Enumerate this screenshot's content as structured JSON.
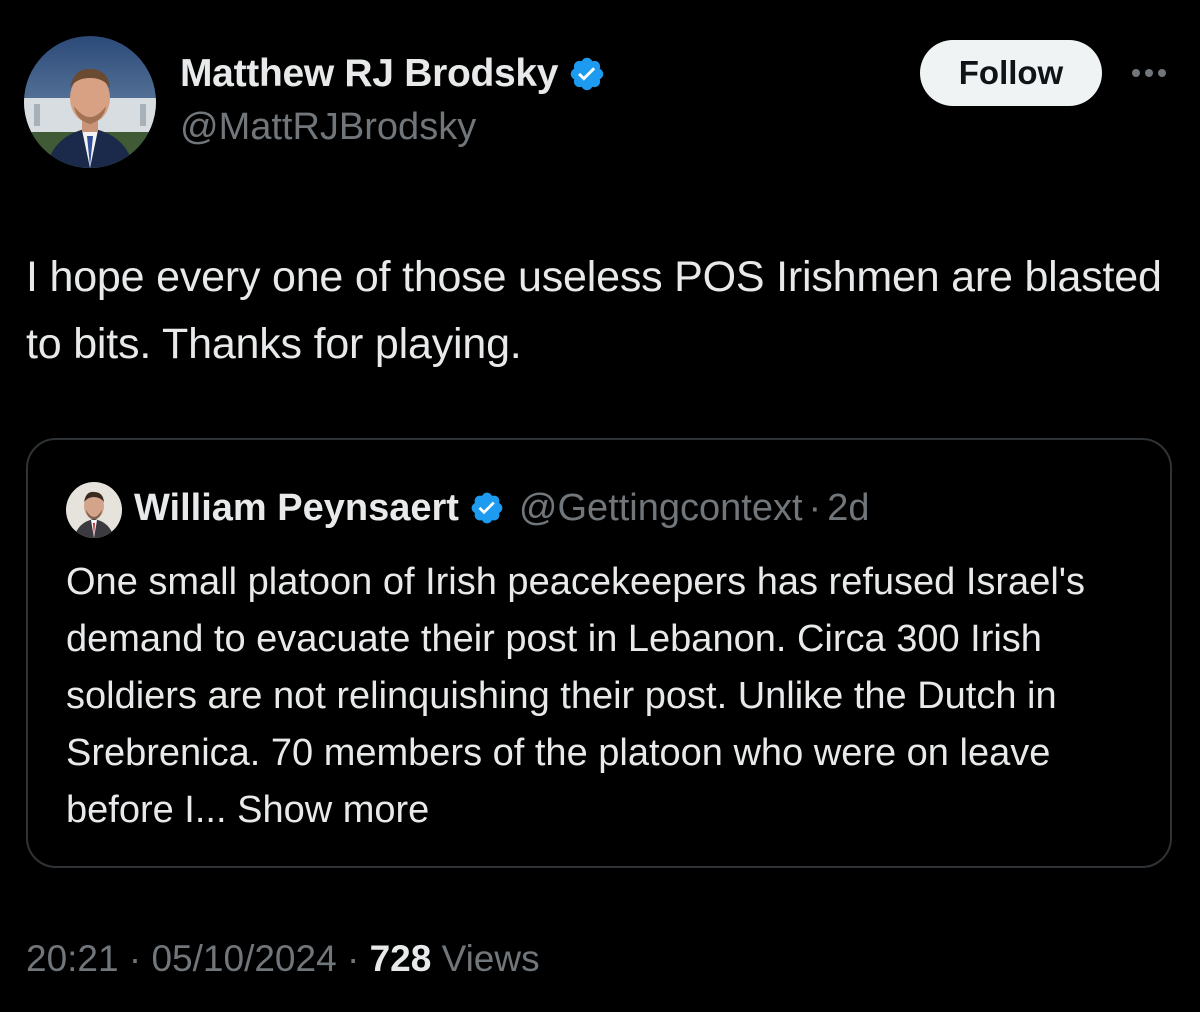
{
  "author": {
    "name": "Matthew RJ Brodsky",
    "handle": "@MattRJBrodsky",
    "verified": true
  },
  "actions": {
    "follow_label": "Follow",
    "more_icon": "more-horizontal-icon"
  },
  "tweet": {
    "text": "I hope every one of those useless POS Irishmen are blasted to bits. Thanks for playing."
  },
  "quoted_tweet": {
    "author_name": "William Peynsaert",
    "handle": "@Gettingcontext",
    "separator": "·",
    "age": "2d",
    "text": "One small platoon of Irish peacekeepers has refused Israel's demand to evacuate their post in Lebanon. Circa 300 Irish soldiers are not relinquishing their post. Unlike the Dutch in Srebrenica. 70 members of the platoon who were on leave before I...",
    "show_more": "Show more"
  },
  "meta": {
    "time": "20:21",
    "sep1": "·",
    "date": "05/10/2024",
    "sep2": "·",
    "views_count": "728",
    "views_label": "Views"
  },
  "colors": {
    "background": "#000000",
    "text_primary": "#e7e9ea",
    "text_secondary": "#71767b",
    "verified_blue": "#1d9bf0",
    "border": "#2f3336"
  }
}
